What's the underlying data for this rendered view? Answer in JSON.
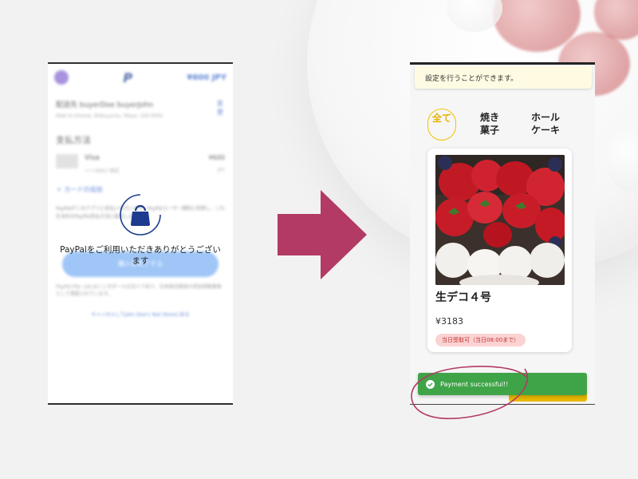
{
  "left_screen": {
    "header": {
      "amount": "¥600 JPY"
    },
    "shipping": {
      "title": "配送先 buyerDoe buyerJohn",
      "address": "Maki 6-ichome, Shibuya-ku, Tokyo, 150-0002",
      "edit_label": "変更"
    },
    "payment_section_title": "支払方法",
    "card": {
      "name": "Visa",
      "number": "••••8803 確認",
      "price": "¥600",
      "currency": "JPY"
    },
    "add_card_label": "＋ カードの追加",
    "terms_text": "PayPalがこのアプリに支払いを行います。PayPalユーザー規約に同意し、これを当社のPayPal支払方法に設定します。",
    "complete_button_label": "購入を完了する",
    "note_text": "PayPal Pte. Ltd.はシンガポールの法人であり、日本国法務省の資金移動業者として登録されています。",
    "cancel_link": "キャンセルしてJohn Doe's Test Storeに戻る",
    "overlay_message": "PayPalをご利用いただきありがとうございます",
    "colors": {
      "paypal_blue": "#1d3b8f",
      "button_blue": "#7fb3f5"
    }
  },
  "arrow": {
    "color": "#b23a64"
  },
  "right_screen": {
    "notice_text": "設定を行うことができます。",
    "tabs": [
      {
        "label": "全て",
        "active": true
      },
      {
        "label": "焼き菓子",
        "active": false
      },
      {
        "label": "ホールケーキ",
        "active": false
      }
    ],
    "product": {
      "name": "生デコ４号",
      "price": "¥3183",
      "badge": "当日受取可（当日08:00まで）"
    },
    "toast": {
      "message": "Payment successful!!",
      "icon": "check-circle-icon",
      "color": "#3fa447"
    },
    "colors": {
      "accent_yellow": "#e8b800",
      "badge_bg": "#fbd3d3"
    }
  }
}
